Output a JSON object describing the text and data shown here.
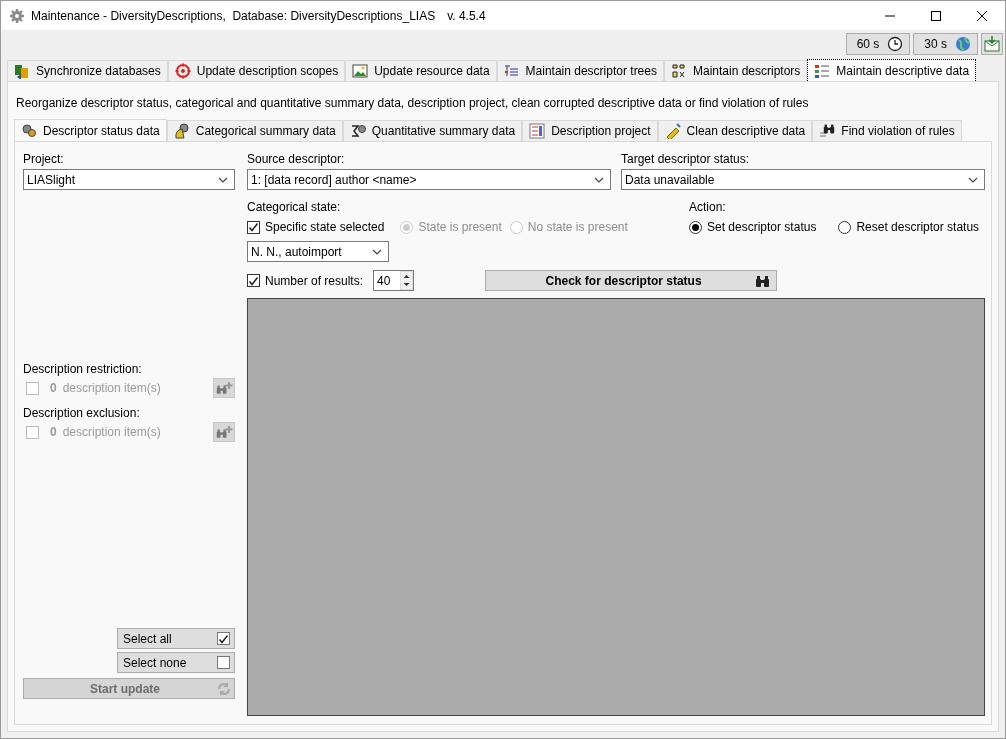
{
  "window": {
    "title": "Maintenance - DiversityDescriptions,  Database: DiversityDescriptions_LIAS",
    "version": "v. 4.5.4"
  },
  "timers": [
    {
      "label": "60 s"
    },
    {
      "label": "30 s"
    }
  ],
  "main_tabs": [
    {
      "label": "Synchronize databases",
      "selected": false
    },
    {
      "label": "Update description scopes",
      "selected": false
    },
    {
      "label": "Update resource data",
      "selected": false
    },
    {
      "label": "Maintain descriptor trees",
      "selected": false
    },
    {
      "label": "Maintain descriptors",
      "selected": false
    },
    {
      "label": "Maintain descriptive data",
      "selected": true
    }
  ],
  "description": "Reorganize descriptor status, categorical and quantitative summary data, description project, clean corrupted descriptive data or find violation of rules",
  "sub_tabs": [
    {
      "label": "Descriptor status data",
      "selected": true
    },
    {
      "label": "Categorical summary data",
      "selected": false
    },
    {
      "label": "Quantitative summary data",
      "selected": false
    },
    {
      "label": "Description project",
      "selected": false
    },
    {
      "label": "Clean descriptive data",
      "selected": false
    },
    {
      "label": "Find violation of rules",
      "selected": false
    }
  ],
  "project": {
    "label": "Project:",
    "value": "LIASlight"
  },
  "source_descriptor": {
    "label": "Source descriptor:",
    "value": "1: [data record] author <name>"
  },
  "target_status": {
    "label": "Target descriptor status:",
    "value": "Data unavailable"
  },
  "categorical_state": {
    "label": "Categorical state:",
    "specific_state": {
      "label": "Specific state selected",
      "checked": true
    },
    "options": [
      {
        "label": "State is present",
        "selected": true,
        "disabled": true
      },
      {
        "label": "No state is present",
        "selected": false,
        "disabled": true
      }
    ],
    "state_value": "N. N., autoimport"
  },
  "action": {
    "label": "Action:",
    "options": [
      {
        "label": "Set descriptor status",
        "selected": true
      },
      {
        "label": "Reset descriptor status",
        "selected": false
      }
    ]
  },
  "number_of_results": {
    "label": "Number of results:",
    "checked": true,
    "value": "40"
  },
  "check_button": "Check for descriptor status",
  "restriction": {
    "label": "Description restriction:",
    "checked": false,
    "disabled": true,
    "count": "0",
    "unit": "description item(s)"
  },
  "exclusion": {
    "label": "Description exclusion:",
    "checked": false,
    "disabled": true,
    "count": "0",
    "unit": "description item(s)"
  },
  "select_all": {
    "label": "Select all",
    "checked": true
  },
  "select_none": {
    "label": "Select none",
    "checked": false
  },
  "start_update": {
    "label": "Start update",
    "disabled": true
  }
}
